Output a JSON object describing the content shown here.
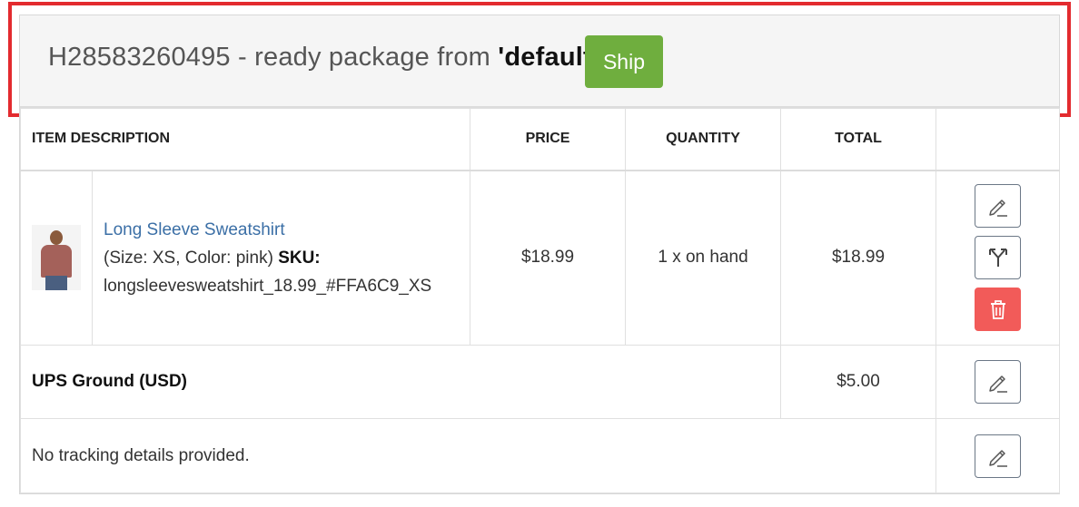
{
  "header": {
    "package_id": "H28583260495",
    "status_text": " - ready package from ",
    "location_name": "'default'",
    "ship_label": "Ship"
  },
  "table": {
    "columns": {
      "description": "ITEM DESCRIPTION",
      "price": "PRICE",
      "quantity": "QUANTITY",
      "total": "TOTAL"
    },
    "items": [
      {
        "name": "Long Sleeve Sweatshirt",
        "options": "(Size: XS, Color: pink)",
        "sku_label": "SKU:",
        "sku": "longsleevesweatshirt_18.99_#FFA6C9_XS",
        "price": "$18.99",
        "quantity": "1 x on hand",
        "total": "$18.99",
        "actions": [
          "pencil-icon",
          "split-icon",
          "trash-icon"
        ]
      }
    ],
    "shipping": {
      "label": "UPS Ground (USD)",
      "total": "$5.00"
    },
    "tracking": {
      "text": "No tracking details provided."
    }
  },
  "colors": {
    "ship_button": "#6fae3e",
    "delete_button": "#f25b59",
    "link": "#3b6fa6",
    "highlight": "#e32b2f"
  }
}
